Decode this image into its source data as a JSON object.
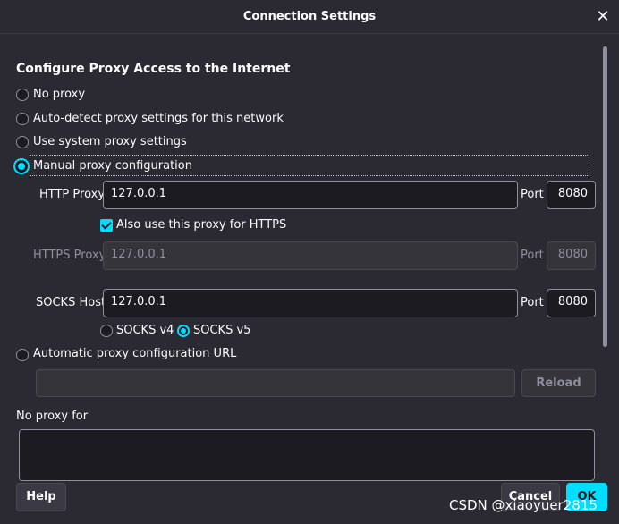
{
  "dialog": {
    "title": "Connection Settings",
    "close_icon": "✕"
  },
  "heading": "Configure Proxy Access to the Internet",
  "options": {
    "no_proxy": "No proxy",
    "auto_detect": "Auto-detect proxy settings for this network",
    "system": "Use system proxy settings",
    "manual": "Manual proxy configuration",
    "auto_url": "Automatic proxy configuration URL"
  },
  "http": {
    "label": "HTTP Proxy",
    "value": "127.0.0.1",
    "port_label": "Port",
    "port": "8080"
  },
  "also_https": "Also use this proxy for HTTPS",
  "https": {
    "label": "HTTPS Proxy",
    "value": "127.0.0.1",
    "port_label": "Port",
    "port": "8080"
  },
  "socks": {
    "label": "SOCKS Host",
    "value": "127.0.0.1",
    "port_label": "Port",
    "port": "8080",
    "v4": "SOCKS v4",
    "v5": "SOCKS v5"
  },
  "auto_url_value": "",
  "reload": "Reload",
  "no_proxy_for": "No proxy for",
  "no_proxy_for_value": "",
  "footer": {
    "help": "Help",
    "cancel": "Cancel",
    "ok": "OK"
  },
  "watermark": "CSDN @xiaoyuer2815",
  "colors": {
    "accent": "#00ddff",
    "background": "#2b2a33",
    "field": "#1c1b22"
  }
}
